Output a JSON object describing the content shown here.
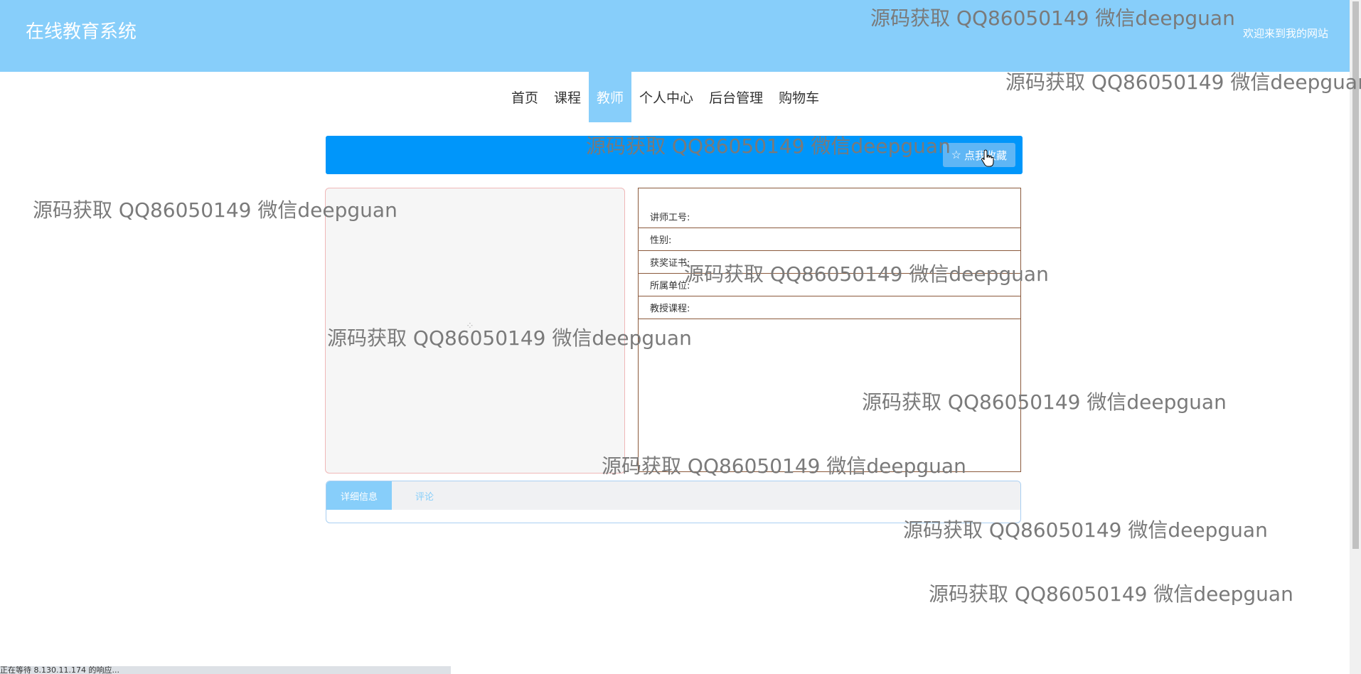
{
  "header": {
    "site_title": "在线教育系统",
    "welcome_text": "欢迎来到我的网站"
  },
  "nav": {
    "items": [
      {
        "label": "首页",
        "active": false
      },
      {
        "label": "课程",
        "active": false
      },
      {
        "label": "教师",
        "active": true
      },
      {
        "label": "个人中心",
        "active": false
      },
      {
        "label": "后台管理",
        "active": false
      },
      {
        "label": "购物车",
        "active": false
      }
    ]
  },
  "favorite": {
    "button_label": "点我收藏",
    "icon": "star-icon"
  },
  "teacher_info": {
    "fields": [
      {
        "label": "讲师工号:",
        "value": ""
      },
      {
        "label": "性别:",
        "value": ""
      },
      {
        "label": "获奖证书:",
        "value": ""
      },
      {
        "label": "所属单位:",
        "value": ""
      },
      {
        "label": "教授课程:",
        "value": ""
      }
    ]
  },
  "tabs": {
    "items": [
      {
        "label": "详细信息",
        "active": true
      },
      {
        "label": "评论",
        "active": false
      }
    ]
  },
  "status_bar": {
    "text": "正在等待 8.130.11.174 的响应..."
  },
  "watermark": {
    "text": "源码获取 QQ86050149 微信deepguan"
  },
  "colors": {
    "header_bg": "#87cefa",
    "fav_bar_bg": "#0096fa",
    "active_tab": "#87cefa",
    "info_border": "#8b5a3c"
  }
}
